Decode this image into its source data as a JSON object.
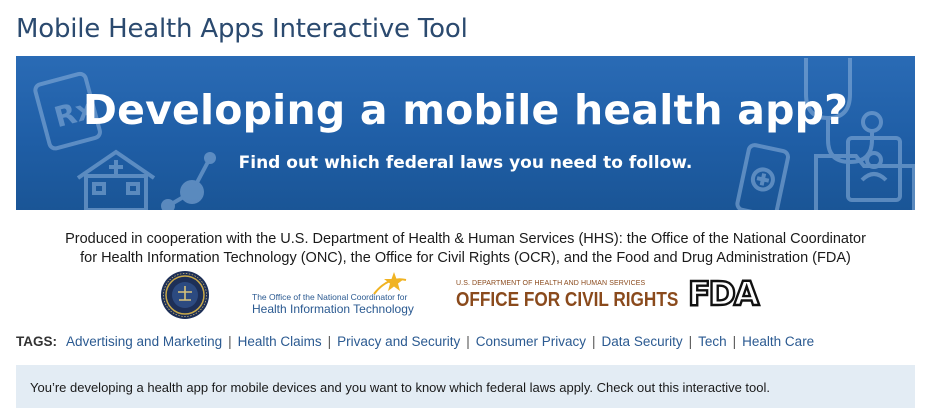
{
  "page": {
    "title": "Mobile Health Apps Interactive Tool"
  },
  "banner": {
    "headline": "Developing a mobile health app?",
    "subheadline": "Find out which federal laws you need to follow."
  },
  "cooperation": {
    "line1": "Produced in cooperation with the U.S. Department of Health & Human Services (HHS): the Office of the National Coordinator",
    "line2": "for Health Information Technology (ONC), the Office for Civil Rights (OCR), and the Food and Drug Administration (FDA)"
  },
  "logos": {
    "onc": {
      "line1": "The Office of the National Coordinator for",
      "line2": "Health Information Technology"
    },
    "ocr": {
      "line1": "U.S. DEPARTMENT OF HEALTH AND HUMAN SERVICES",
      "line2": "OFFICE FOR CIVIL RIGHTS"
    },
    "fda": {
      "text": "FDA"
    }
  },
  "tags": {
    "label": "TAGS:",
    "items": [
      "Advertising and Marketing",
      "Health Claims",
      "Privacy and Security",
      "Consumer Privacy",
      "Data Security",
      "Tech",
      "Health Care"
    ],
    "separator": "|"
  },
  "notice": {
    "text": "You’re developing a health app for mobile devices and you want to know which federal laws apply. Check out this interactive tool."
  },
  "colors": {
    "title": "#2b4a6f",
    "banner": "#1f5ea6",
    "link": "#2b5a91",
    "notice_bg": "#e3ecf4",
    "ocr_brown": "#8a4a1c"
  }
}
